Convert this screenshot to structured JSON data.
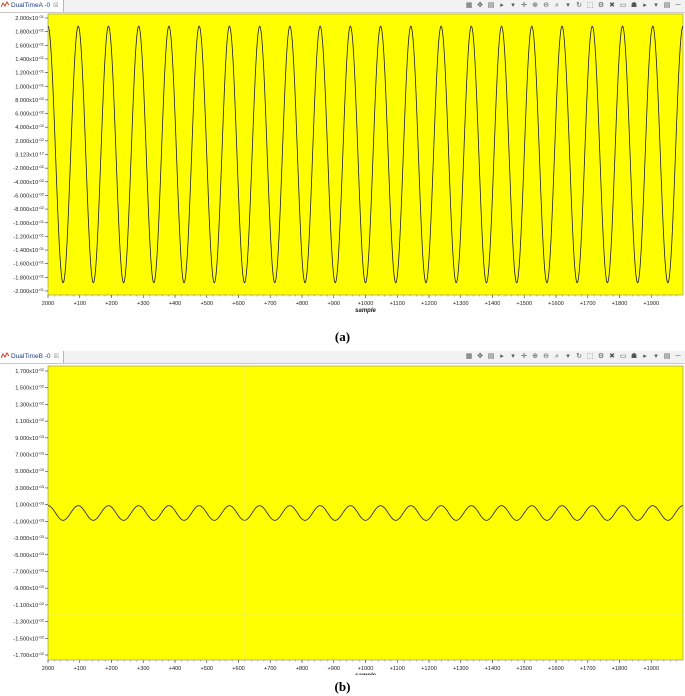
{
  "panels": [
    {
      "tab_title": "DualTimeA -0",
      "tab_close": "☒",
      "caption": "(a)",
      "chart_data": {
        "type": "line",
        "xlabel": "sample",
        "x_ticks": [
          "2000",
          "+100",
          "+200",
          "+300",
          "+400",
          "+500",
          "+600",
          "+700",
          "+800",
          "+900",
          "+1000",
          "+1100",
          "+1200",
          "+1300",
          "+1400",
          "+1500",
          "+1600",
          "+1700",
          "+1800",
          "+1900"
        ],
        "y_ticks": [
          "2.000x10^-01",
          "1.800x10^-01",
          "1.600x10^-01",
          "1.400x10^-01",
          "1.200x10^-01",
          "1.000x10^-01",
          "8.000x10^-02",
          "6.000x10^-02",
          "4.000x10^-02",
          "2.000x10^-02",
          "3.123x10^-17",
          "-2.000x10^-02",
          "-4.000x10^-02",
          "-6.000x10^-02",
          "-8.000x10^-02",
          "-1.000x10^-01",
          "-1.200x10^-01",
          "-1.400x10^-01",
          "-1.600x10^-01",
          "-1.800x10^-01",
          "-2.000x10^-01"
        ],
        "ylim": [
          -0.2,
          0.2
        ],
        "xlim": [
          0,
          2000
        ],
        "series": [
          {
            "amplitude": 0.188,
            "cycles": 21,
            "phase_deg": 90
          }
        ],
        "background": "#ffff00",
        "line_color": "#1a1a4a"
      }
    },
    {
      "tab_title": "DualTimeB -0",
      "tab_close": "☒",
      "caption": "(b)",
      "chart_data": {
        "type": "line",
        "xlabel": "sample",
        "x_ticks": [
          "2000",
          "+100",
          "+200",
          "+300",
          "+400",
          "+500",
          "+600",
          "+700",
          "+800",
          "+900",
          "+1000",
          "+1100",
          "+1200",
          "+1300",
          "+1400",
          "+1500",
          "+1600",
          "+1700",
          "+1800",
          "+1900"
        ],
        "y_ticks": [
          "1.700x10^-02",
          "1.500x10^-02",
          "1.300x10^-02",
          "1.100x10^-02",
          "9.000x10^-03",
          "7.000x10^-03",
          "5.000x10^-03",
          "3.000x10^-03",
          "1.000x10^-03",
          "-1.000x10^-03",
          "-3.000x10^-03",
          "-5.000x10^-03",
          "-7.000x10^-03",
          "-9.000x10^-03",
          "-1.100x10^-02",
          "-1.300x10^-02",
          "-1.500x10^-02",
          "-1.700x10^-02"
        ],
        "ylim": [
          -0.0175,
          0.0175
        ],
        "xlim": [
          0,
          2000
        ],
        "series": [
          {
            "amplitude": 0.0009,
            "cycles": 21,
            "phase_deg": 90
          }
        ],
        "background": "#ffff00",
        "line_color": "#1a1a4a"
      }
    }
  ],
  "toolbar_icons": [
    "layout-icon",
    "cursor-icon",
    "grid-icon",
    "play-icon",
    "menu-icon",
    "zoom-in-icon",
    "zoom-out-icon",
    "zoom-fit-icon",
    "menu-icon",
    "refresh-icon",
    "select-icon",
    "settings-icon",
    "delete-icon",
    "window-icon",
    "binoculars-icon",
    "menu-icon",
    "table-icon",
    "window-icon",
    "minimize-icon",
    "maximize-icon"
  ],
  "toolbar_glyphs": [
    "▦",
    "✥",
    "▤",
    "▸",
    "▾",
    "✛",
    "⊕",
    "⊖",
    "⌕",
    "▾",
    "↻",
    "⬚",
    "⚙",
    "✖",
    "▭",
    "☗",
    "▸",
    "▾",
    "▤",
    "─"
  ]
}
